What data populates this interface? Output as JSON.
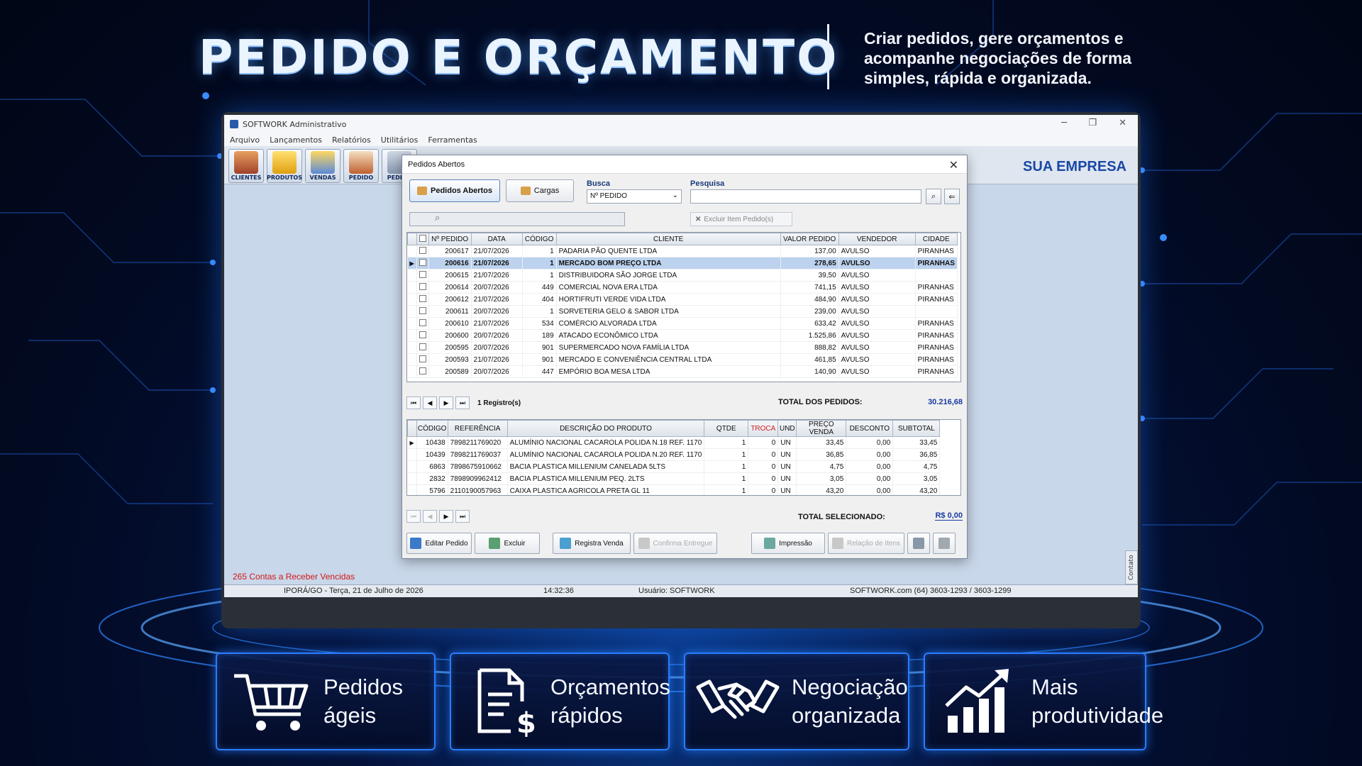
{
  "headline": {
    "title": "PEDIDO E ORÇAMENTO",
    "subtitle": "Criar pedidos, gere orçamentos e acompanhe negociações de forma simples, rápida e organizada."
  },
  "app": {
    "window_title": "SOFTWORK Administrativo",
    "menu": [
      "Arquivo",
      "Lançamentos",
      "Relatórios",
      "Utilitários",
      "Ferramentas"
    ],
    "toolbar": [
      "CLIENTES",
      "PRODUTOS",
      "VENDAS",
      "PEDIDO",
      "PEDIDO"
    ],
    "company": "SUA EMPRESA",
    "alert": "265 Contas a Receber Vencidas",
    "contato": "Contato",
    "status": {
      "location": "IPORÁ/GO - Terça, 21 de Julho de 2026",
      "time": "14:32:36",
      "user": "Usuário: SOFTWORK",
      "contact": "SOFTWORK.com (64) 3603-1293 / 3603-1299"
    }
  },
  "dialog": {
    "title": "Pedidos Abertos",
    "tabs": [
      "Pedidos Abertos",
      "Cargas"
    ],
    "busca_label": "Busca",
    "busca_value": "Nº PEDIDO",
    "pesquisa_label": "Pesquisa",
    "excluir_item": "Excluir Item Pedido(s)",
    "orders_headers": [
      "Nº PEDIDO",
      "DATA",
      "CÓDIGO",
      "CLIENTE",
      "VALOR PEDIDO",
      "VENDEDOR",
      "CIDADE"
    ],
    "orders": [
      [
        "200617",
        "21/07/2026",
        "1",
        "PADARIA PÃO QUENTE LTDA",
        "137,00",
        "AVULSO",
        "PIRANHAS"
      ],
      [
        "200616",
        "21/07/2026",
        "1",
        "MERCADO BOM PREÇO LTDA",
        "278,65",
        "AVULSO",
        "PIRANHAS"
      ],
      [
        "200615",
        "21/07/2026",
        "1",
        "DISTRIBUIDORA SÃO JORGE LTDA",
        "39,50",
        "AVULSO",
        ""
      ],
      [
        "200614",
        "20/07/2026",
        "449",
        "COMERCIAL NOVA ERA LTDA",
        "741,15",
        "AVULSO",
        "PIRANHAS"
      ],
      [
        "200612",
        "21/07/2026",
        "404",
        "HORTIFRUTI VERDE VIDA LTDA",
        "484,90",
        "AVULSO",
        "PIRANHAS"
      ],
      [
        "200611",
        "20/07/2026",
        "1",
        "SORVETERIA GELO & SABOR LTDA",
        "239,00",
        "AVULSO",
        ""
      ],
      [
        "200610",
        "21/07/2026",
        "534",
        "COMÉRCIO ALVORADA LTDA",
        "633,42",
        "AVULSO",
        "PIRANHAS"
      ],
      [
        "200600",
        "20/07/2026",
        "189",
        "ATACADO ECONÔMICO LTDA",
        "1.525,86",
        "AVULSO",
        "PIRANHAS"
      ],
      [
        "200595",
        "20/07/2026",
        "901",
        "SUPERMERCADO NOVA FAMÍLIA LTDA",
        "888,82",
        "AVULSO",
        "PIRANHAS"
      ],
      [
        "200593",
        "21/07/2026",
        "901",
        "MERCADO E CONVENIÊNCIA CENTRAL LTDA",
        "461,85",
        "AVULSO",
        "PIRANHAS"
      ],
      [
        "200589",
        "20/07/2026",
        "447",
        "EMPÓRIO BOA MESA LTDA",
        "140,90",
        "AVULSO",
        "PIRANHAS"
      ]
    ],
    "selected_order_index": 1,
    "registros": "1 Registro(s)",
    "total_pedidos_label": "TOTAL DOS PEDIDOS:",
    "total_pedidos_value": "30.216,68",
    "items_headers": [
      "CÓDIGO",
      "REFERÊNCIA",
      "DESCRIÇÃO DO PRODUTO",
      "QTDE",
      "TROCA",
      "UND",
      "PREÇO VENDA",
      "DESCONTO",
      "SUBTOTAL"
    ],
    "items": [
      [
        "10438",
        "7898211769020",
        "ALUMÍNIO NACIONAL CACAROLA POLIDA N.18 REF. 1170",
        "1",
        "0",
        "UN",
        "33,45",
        "0,00",
        "33,45"
      ],
      [
        "10439",
        "7898211769037",
        "ALUMÍNIO NACIONAL CACAROLA POLIDA N.20 REF. 1170",
        "1",
        "0",
        "UN",
        "36,85",
        "0,00",
        "36,85"
      ],
      [
        "6863",
        "7898675910662",
        "BACIA PLASTICA MILLENIUM CANELADA 5LTS",
        "1",
        "0",
        "UN",
        "4,75",
        "0,00",
        "4,75"
      ],
      [
        "2832",
        "7898909962412",
        "BACIA PLASTICA MILLENIUM PEQ. 2LTS",
        "1",
        "0",
        "UN",
        "3,05",
        "0,00",
        "3,05"
      ],
      [
        "5796",
        "2110190057963",
        "CAIXA PLASTICA AGRICOLA PRETA GL 11",
        "1",
        "0",
        "UN",
        "43,20",
        "0,00",
        "43,20"
      ]
    ],
    "total_sel_label": "TOTAL SELECIONADO:",
    "total_sel_value": "R$ 0,00",
    "actions": [
      "Editar Pedido",
      "Excluir",
      "Registra Venda",
      "Confirma Entregue",
      "Impressão",
      "Relação de Itens"
    ]
  },
  "features": [
    {
      "icon": "cart-icon",
      "line1": "Pedidos ágeis",
      "line2": ""
    },
    {
      "icon": "document-dollar-icon",
      "line1": "Orçamentos",
      "line2": "rápidos"
    },
    {
      "icon": "handshake-icon",
      "line1": "Negociação",
      "line2": "organizada"
    },
    {
      "icon": "growth-chart-icon",
      "line1": "Mais",
      "line2": "produtividade"
    }
  ]
}
